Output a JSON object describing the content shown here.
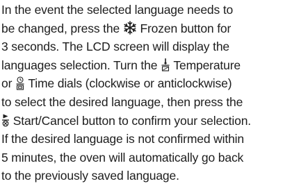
{
  "paragraph": {
    "line1": "In the event the selected language needs to",
    "line2_a": "be changed, press the ",
    "line2_b": " Frozen button for",
    "line3": "3 seconds. The LCD screen will display the",
    "line4_a": "languages selection. Turn the ",
    "line4_b": " Temperature",
    "line5_a": "or ",
    "line5_b": " Time dials (clockwise or anticlockwise)",
    "line6": "to select the desired language, then press the",
    "line7_b": " Start/Cancel button to confirm your selection.",
    "line8": "If the desired language is not confirmed within",
    "line9": "5 minutes, the oven will automatically go back",
    "line10": "to the previously saved language."
  },
  "icons": {
    "frozen": "snowflake-icon",
    "temperature": "thermometer-icon",
    "time": "clock-icon",
    "start_cancel": "start-cancel-icon"
  }
}
